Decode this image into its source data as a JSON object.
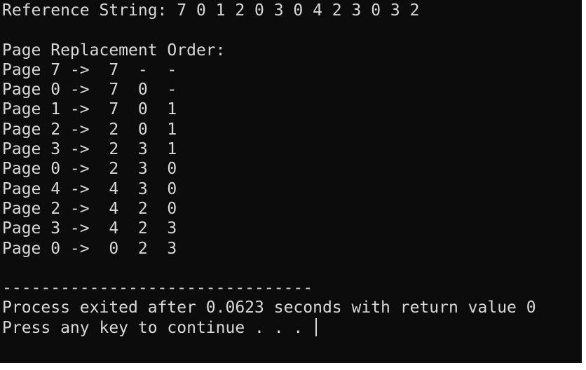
{
  "console": {
    "reference_string_line": "Reference String: 7 0 1 2 0 3 0 4 2 3 0 3 2",
    "blank_line": "",
    "replacement_header": "Page Replacement Order:",
    "rows": [
      "Page 7 ->  7  -  -",
      "Page 0 ->  7  0  -",
      "Page 1 ->  7  0  1",
      "Page 2 ->  2  0  1",
      "Page 3 ->  2  3  1",
      "Page 0 ->  2  3  0",
      "Page 4 ->  4  3  0",
      "Page 2 ->  4  2  0",
      "Page 3 ->  4  2  3",
      "Page 0 ->  0  2  3"
    ],
    "separator": "--------------------------------",
    "process_exit": "Process exited after 0.0623 seconds with return value 0",
    "press_key": "Press any key to continue . . . "
  }
}
